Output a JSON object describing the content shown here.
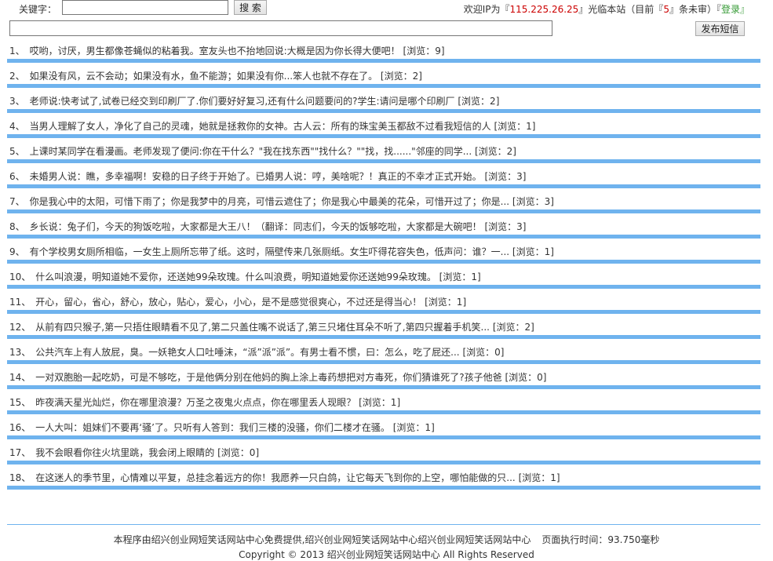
{
  "search": {
    "label": "关键字：",
    "value": "",
    "button": "搜 索"
  },
  "welcome": {
    "prefix": "欢迎IP为『",
    "ip": "115.225.26.25",
    "mid": "』光临本站（目前『",
    "pending_count": "5",
    "suffix": "』条未审）『",
    "login": "登录",
    "end": "』"
  },
  "compose": {
    "value": "",
    "button": "发布短信"
  },
  "items": [
    {
      "num": "1、",
      "text": "哎哟，讨厌，男生都像苍蝇似的粘着我。室友头也不抬地回说:大概是因为你长得大便吧！",
      "views": "[浏览：9]"
    },
    {
      "num": "2、",
      "text": "如果没有风，云不会动；如果没有水，鱼不能游；如果没有你...笨人也就不存在了。",
      "views": "[浏览：2]"
    },
    {
      "num": "3、",
      "text": "老师说:快考试了,试卷已经交到印刷厂了.你们要好好复习,还有什么问题要问的?学生:请问是哪个印刷厂",
      "views": "[浏览：2]"
    },
    {
      "num": "4、",
      "text": "当男人理解了女人，净化了自己的灵魂，她就是拯救你的女神。古人云：所有的珠宝美玉都敌不过看我短信的人",
      "views": "[浏览：1]"
    },
    {
      "num": "5、",
      "text": "上课时某同学在看漫画。老师发现了便问:你在干什么？\"我在找东西\"\"找什么？\"\"找，找......\"邻座的同学...",
      "views": "[浏览：2]"
    },
    {
      "num": "6、",
      "text": "未婚男人说：瞧，多幸福啊！安稳的日子终于开始了。已婚男人说：哼，美啥呢？！真正的不幸才正式开始。",
      "views": "[浏览：3]"
    },
    {
      "num": "7、",
      "text": "你是我心中的太阳，可惜下雨了；你是我梦中的月亮，可惜云遮住了；你是我心中最美的花朵，可惜开过了；你是...",
      "views": "[浏览：3]"
    },
    {
      "num": "8、",
      "text": "乡长说：兔子们，今天的狗饭吃啦，大家都是大王八！（翻译：同志们，今天的饭够吃啦，大家都是大碗吧！",
      "views": "[浏览：3]"
    },
    {
      "num": "9、",
      "text": "有个学校男女厕所相临，一女生上厕所忘带了纸。这时，隔壁传来几张厕纸。女生吓得花容失色，低声问：谁？一...",
      "views": "[浏览：1]"
    },
    {
      "num": "10、",
      "text": "什么叫浪漫，明知道她不爱你，还送她99朵玫瑰。什么叫浪费，明知道她爱你还送她99朵玫瑰。",
      "views": "[浏览：1]"
    },
    {
      "num": "11、",
      "text": "开心，留心，省心，舒心，放心，贴心，爱心，小心，是不是感觉很爽心，不过还是得当心！",
      "views": "[浏览：1]"
    },
    {
      "num": "12、",
      "text": "从前有四只猴子,第一只捂住眼睛看不见了,第二只盖住嘴不说话了,第三只堵住耳朵不听了,第四只握着手机笑...",
      "views": "[浏览：2]"
    },
    {
      "num": "13、",
      "text": "公共汽车上有人放屁，臭。一妖艳女人口吐唾沫，“派”派”派”。有男士看不惯，曰：怎么，吃了屁还...",
      "views": "[浏览：0]"
    },
    {
      "num": "14、",
      "text": "一对双胞胎一起吃奶，可是不够吃，于是他俩分别在他妈的胸上涂上毒药想把对方毒死，你们猜谁死了?孩子他爸",
      "views": "[浏览：0]"
    },
    {
      "num": "15、",
      "text": "昨夜满天星光灿烂，你在哪里浪漫？万圣之夜鬼火点点，你在哪里丢人现眼？",
      "views": "[浏览：1]"
    },
    {
      "num": "16、",
      "text": "一人大叫：姐妹们不要再‘骚’了。只听有人答到：我们三楼的没骚，你们二楼才在骚。",
      "views": "[浏览：1]"
    },
    {
      "num": "17、",
      "text": "我不会眼看你往火坑里跳，我会闭上眼睛的",
      "views": "[浏览：0]"
    },
    {
      "num": "18、",
      "text": "在这迷人的季节里，心情难以平复，总挂念着远方的你！我愿养一只白鸽，让它每天飞到你的上空，哪怕能做的只...",
      "views": "[浏览：1]"
    }
  ],
  "footer": {
    "provided_by": "本程序由绍兴创业网短笑话网站中心免费提供,绍兴创业网短笑话网站中心绍兴创业网短笑话网站中心",
    "exec_time": "页面执行时间：93.750毫秒",
    "copyright": "Copyright © 2013 绍兴创业网短笑话网站中心 All Rights Reserved"
  },
  "colors": {
    "accent_bar": "#6fb3ee",
    "ip_red": "#cc0000",
    "login_green": "#339933"
  }
}
